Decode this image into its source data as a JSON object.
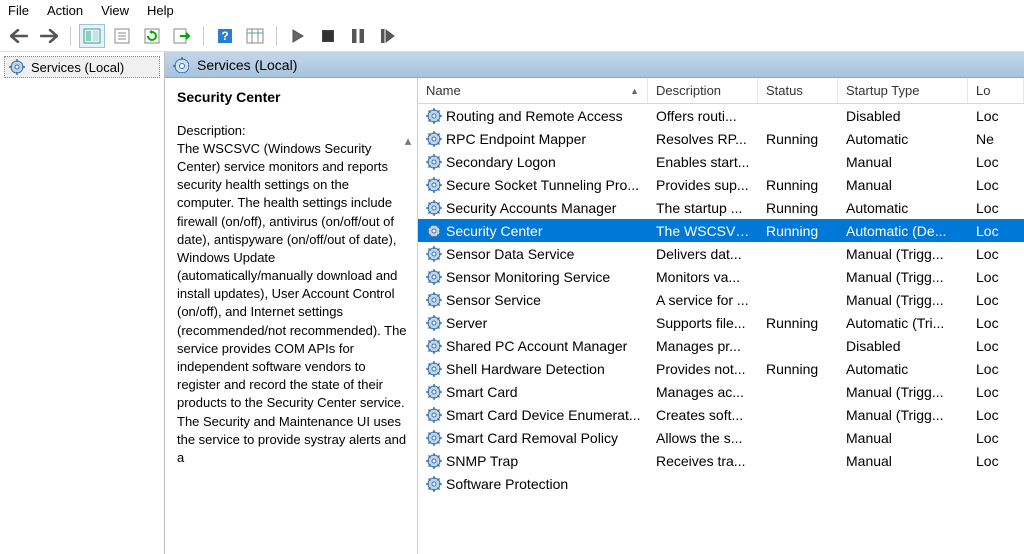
{
  "menu": {
    "items": [
      "File",
      "Action",
      "View",
      "Help"
    ]
  },
  "nav": {
    "label": "Services (Local)"
  },
  "header": {
    "title": "Services (Local)"
  },
  "detail": {
    "title": "Security Center",
    "desc_label": "Description:",
    "desc_text": "The WSCSVC (Windows Security Center) service monitors and reports security health settings on the computer.  The health settings include firewall (on/off), antivirus (on/off/out of date), antispyware (on/off/out of date), Windows Update (automatically/manually download and install updates), User Account Control (on/off), and Internet settings (recommended/not recommended).  The service provides COM APIs for independent software vendors to register and record the state of their products to the Security Center service.  The Security and Maintenance UI uses the service to provide systray alerts and a"
  },
  "columns": {
    "name": "Name",
    "desc": "Description",
    "stat": "Status",
    "start": "Startup Type",
    "log": "Lo"
  },
  "rows": [
    {
      "name": "Routing and Remote Access",
      "desc": "Offers routi...",
      "stat": "",
      "start": "Disabled",
      "log": "Loc"
    },
    {
      "name": "RPC Endpoint Mapper",
      "desc": "Resolves RP...",
      "stat": "Running",
      "start": "Automatic",
      "log": "Ne"
    },
    {
      "name": "Secondary Logon",
      "desc": "Enables start...",
      "stat": "",
      "start": "Manual",
      "log": "Loc"
    },
    {
      "name": "Secure Socket Tunneling Pro...",
      "desc": "Provides sup...",
      "stat": "Running",
      "start": "Manual",
      "log": "Loc"
    },
    {
      "name": "Security Accounts Manager",
      "desc": "The startup ...",
      "stat": "Running",
      "start": "Automatic",
      "log": "Loc"
    },
    {
      "name": "Security Center",
      "desc": "The WSCSVC...",
      "stat": "Running",
      "start": "Automatic (De...",
      "log": "Loc",
      "selected": true
    },
    {
      "name": "Sensor Data Service",
      "desc": "Delivers dat...",
      "stat": "",
      "start": "Manual (Trigg...",
      "log": "Loc"
    },
    {
      "name": "Sensor Monitoring Service",
      "desc": "Monitors va...",
      "stat": "",
      "start": "Manual (Trigg...",
      "log": "Loc"
    },
    {
      "name": "Sensor Service",
      "desc": "A service for ...",
      "stat": "",
      "start": "Manual (Trigg...",
      "log": "Loc"
    },
    {
      "name": "Server",
      "desc": "Supports file...",
      "stat": "Running",
      "start": "Automatic (Tri...",
      "log": "Loc"
    },
    {
      "name": "Shared PC Account Manager",
      "desc": "Manages pr...",
      "stat": "",
      "start": "Disabled",
      "log": "Loc"
    },
    {
      "name": "Shell Hardware Detection",
      "desc": "Provides not...",
      "stat": "Running",
      "start": "Automatic",
      "log": "Loc"
    },
    {
      "name": "Smart Card",
      "desc": "Manages ac...",
      "stat": "",
      "start": "Manual (Trigg...",
      "log": "Loc"
    },
    {
      "name": "Smart Card Device Enumerat...",
      "desc": "Creates soft...",
      "stat": "",
      "start": "Manual (Trigg...",
      "log": "Loc"
    },
    {
      "name": "Smart Card Removal Policy",
      "desc": "Allows the s...",
      "stat": "",
      "start": "Manual",
      "log": "Loc"
    },
    {
      "name": "SNMP Trap",
      "desc": "Receives tra...",
      "stat": "",
      "start": "Manual",
      "log": "Loc"
    },
    {
      "name": "Software Protection",
      "desc": "",
      "stat": "",
      "start": "",
      "log": ""
    }
  ]
}
